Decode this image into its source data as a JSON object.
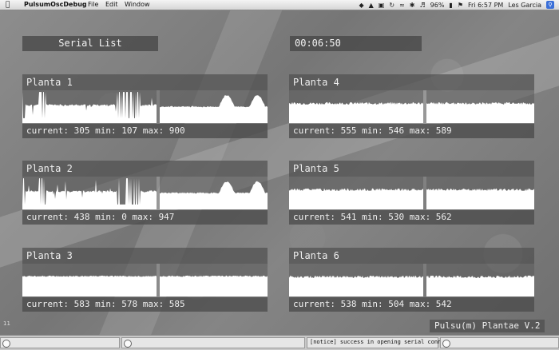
{
  "menubar": {
    "apple": "",
    "app_name": "PulsumOscDebug",
    "menus": [
      "File",
      "Edit",
      "Window"
    ],
    "battery": "96%",
    "clock": "Fri 6:57 PM",
    "user": "Les Garcia"
  },
  "app": {
    "serial_list_label": "Serial List",
    "timer": "00:06:50",
    "brand": "Pulsu(m) Plantae V.2",
    "corner_number": "11"
  },
  "plants": [
    {
      "title": "Planta 1",
      "stats": "current: 305 min: 107 max: 900"
    },
    {
      "title": "Planta 2",
      "stats": "current: 438 min: 0 max: 947"
    },
    {
      "title": "Planta 3",
      "stats": "current: 583 min: 578 max: 585"
    },
    {
      "title": "Planta 4",
      "stats": "current: 555 min: 546 max: 589"
    },
    {
      "title": "Planta 5",
      "stats": "current: 541 min: 530 max: 562"
    },
    {
      "title": "Planta 6",
      "stats": "current: 538 min: 504 max: 542"
    }
  ],
  "console": {
    "message": "[notice] success in opening serial connection"
  },
  "colors": {
    "waveform": "#ffffff",
    "panel": "#505050"
  }
}
